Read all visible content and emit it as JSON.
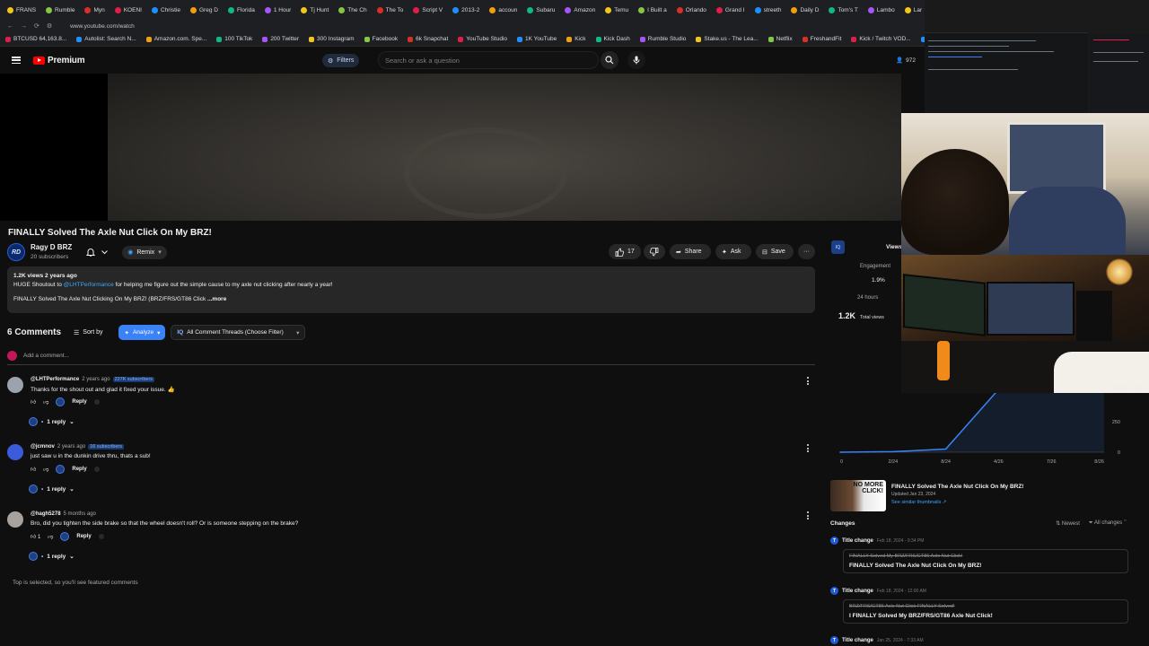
{
  "browser": {
    "tabs": [
      "FRANS",
      "Rumble",
      "Myn",
      "KOENI",
      "Christie",
      "Greg D",
      "Florida",
      "1 Hour",
      "Tj Hunt",
      "The Ch",
      "The To",
      "Script V",
      "2013-2",
      "accoun",
      "Subaru",
      "Amazon",
      "Temu",
      "I Built a",
      "Orlando",
      "Grand I",
      "streeth",
      "Daily D",
      "Tom's T",
      "Lambo",
      "Lar"
    ],
    "url": "www.youtube.com/watch",
    "bookmarks": [
      "BTCUSD 64,163.8...",
      "Autolist: Search N...",
      "Amazon.com. Spe...",
      "100 TikTok",
      "200 Twitter",
      "300 Instagram",
      "Facebook",
      "6k Snapchat",
      "YouTube Studio",
      "1K YouTube",
      "Kick",
      "Kick Dash",
      "Rumble Studio",
      "Stake.us - The Lea...",
      "Netflix",
      "FreshandFit",
      "Kick / Twitch VOD...",
      "FRANS"
    ]
  },
  "header": {
    "logo_text": "Premium",
    "filters_label": "Filters",
    "search_placeholder": "Search or ask a question",
    "right_count": "972"
  },
  "video": {
    "title": "FINALLY Solved The Axle Nut Click On My BRZ!",
    "channel_name": "Ragy D BRZ",
    "subscribers": "20 subscribers",
    "avatar_initials": "RD",
    "remix_label": "Remix",
    "likes": "17",
    "share_label": "Share",
    "ask_label": "Ask",
    "save_label": "Save"
  },
  "description": {
    "meta": "1.2K views  2 years ago",
    "line1_before": "HUGE Shoutout to ",
    "line1_link": "@LHTPerformance",
    "line1_after": " for helping me figure out the simple cause to my axle nut clicking after nearly a year!",
    "line2": "FINALLY Solved The Axle Nut Clicking On My BRZ! (BRZ/FRS/GT86 Click",
    "more_label": "...more"
  },
  "comments": {
    "count_label": "6 Comments",
    "sort_label": "Sort by",
    "analyze_label": "Analyze",
    "threads_label": "All Comment Threads (Choose Filter)",
    "add_placeholder": "Add a comment...",
    "reply_label": "Reply",
    "items": [
      {
        "author": "@LHTPerformance",
        "time": "2 years ago",
        "subs": "227K subscribers",
        "text": "Thanks for the shout out and glad it fixed your issue. 👍",
        "likes": "",
        "replies": "1 reply"
      },
      {
        "author": "@jcmnov",
        "time": "2 years ago",
        "subs": "16 subscribers",
        "text": "just saw u in the dunkin drive thru, thats a sub!",
        "likes": "",
        "replies": "1 reply"
      },
      {
        "author": "@hagh5278",
        "time": "5 months ago",
        "subs": "",
        "text": "Bro, did you tighten the side brake so that the wheel doesn't roll? Or is someone stepping on the brake?",
        "likes": "1",
        "replies": "1 reply"
      }
    ],
    "top_note": "Top is selected, so you'll see featured comments"
  },
  "panel": {
    "logo": "IQ",
    "views_tab": "Views",
    "engagement_label": "Engagement",
    "engagement_value": "1.9%",
    "period_label": "24 hours",
    "total_value": "1.2K",
    "total_label": "Total views",
    "video_card": {
      "thumb_text": "NO MORE CLICK!",
      "title": "FINALLY Solved The Axle Nut Click On My BRZ!",
      "updated": "Updated Jan 23, 2024",
      "similar": "See similar thumbnails ↗"
    },
    "changes_label": "Changes",
    "newest_label": "Newest",
    "all_changes_label": "All changes",
    "changes": [
      {
        "type": "Title change",
        "time": "Feb 18, 2024 - 9:34 PM",
        "old": "FINALLY Solved My BRZ/FRS/GT86 Axle Nut Click!",
        "new": "FINALLY Solved The Axle Nut Click On My BRZ!"
      },
      {
        "type": "Title change",
        "time": "Feb 18, 2024 - 12:00 AM",
        "old": "BRZ/FRS/GT86 Axle Nut Click FINALLY Solved!",
        "new": "I FINALLY Solved My BRZ/FRS/GT86 Axle Nut Click!"
      },
      {
        "type": "Title change",
        "time": "Jan 25, 2024 - 7:33 AM",
        "old": "",
        "new": ""
      }
    ],
    "webcam_label": "ood Cam"
  },
  "chart_data": {
    "type": "line",
    "x": [
      "0",
      "2/24",
      "8/24",
      "4/26",
      "7/26",
      "8/26"
    ],
    "y_ticks": [
      "250",
      "0"
    ],
    "series": [
      {
        "values": [
          0,
          10,
          60,
          1200,
          1200,
          1200
        ]
      }
    ]
  }
}
